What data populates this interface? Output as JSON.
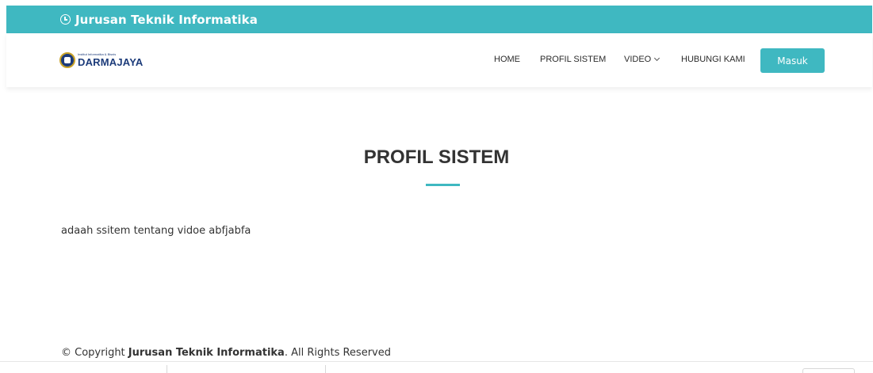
{
  "topbar": {
    "icon": "clock-icon",
    "title": "Jurusan Teknik Informatika"
  },
  "navbar": {
    "logo": {
      "small_text": "Institut Informatika & Bisnis",
      "brand": "DARMAJAYA"
    },
    "menu": [
      {
        "label": "HOME"
      },
      {
        "label": "PROFIL SISTEM"
      },
      {
        "label": "VIDEO",
        "has_dropdown": true
      },
      {
        "label": "HUBUNGI KAMI"
      }
    ],
    "login_button": "Masuk"
  },
  "main": {
    "title": "PROFIL SISTEM",
    "description": "adaah ssitem tentang vidoe abfjabfa"
  },
  "footer": {
    "prefix": "© Copyright ",
    "org": "Jurusan Teknik Informatika",
    "suffix": ". All Rights Reserved"
  },
  "colors": {
    "accent": "#3fb8c1",
    "brand": "#1c3b7a"
  }
}
